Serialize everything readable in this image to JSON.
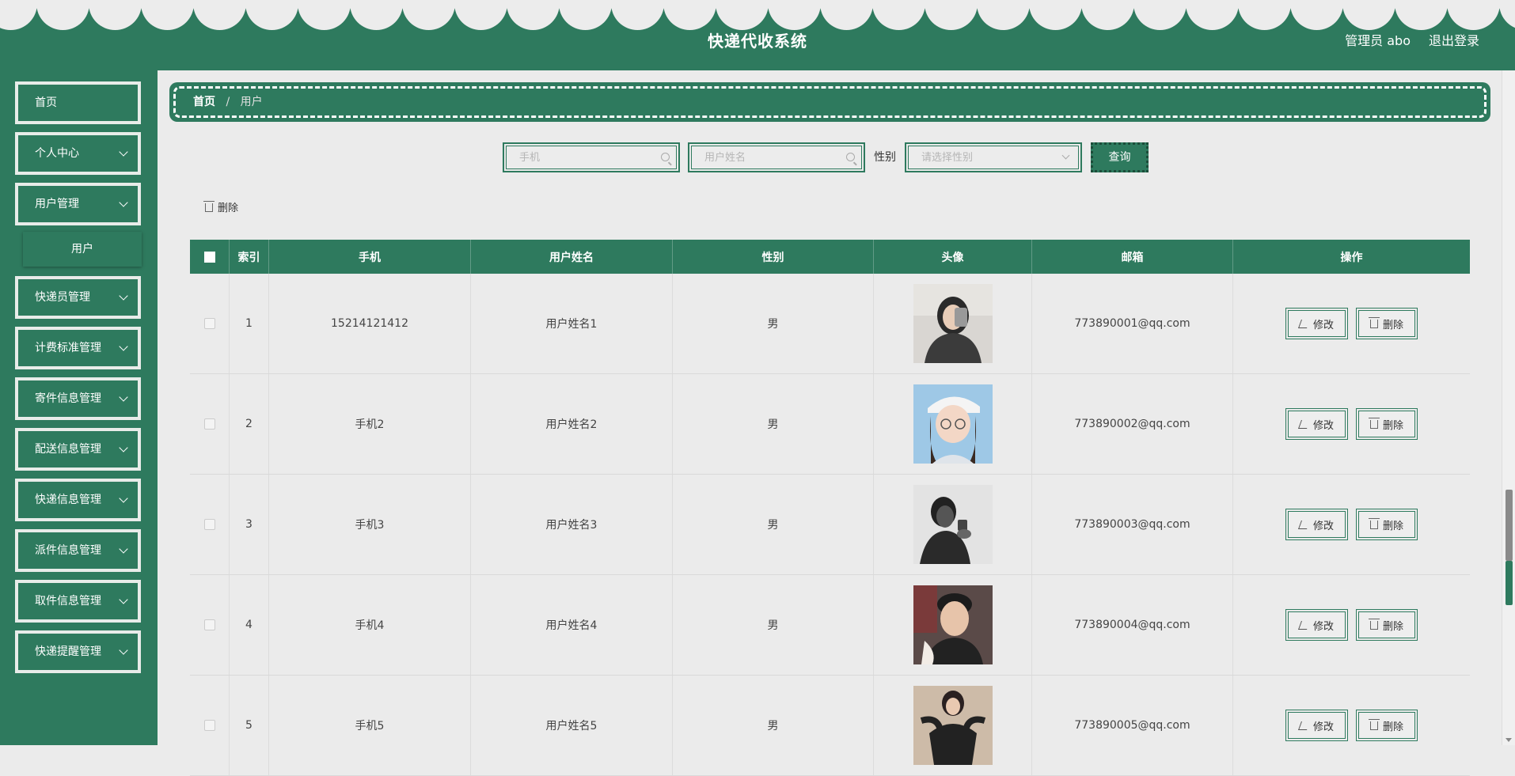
{
  "header": {
    "title": "快递代收系统",
    "user": "管理员 abo",
    "logout": "退出登录"
  },
  "sidebar": {
    "items": [
      {
        "label": "首页",
        "has_arrow": false
      },
      {
        "label": "个人中心",
        "has_arrow": true
      },
      {
        "label": "用户管理",
        "has_arrow": true
      },
      {
        "label": "快递员管理",
        "has_arrow": true
      },
      {
        "label": "计费标准管理",
        "has_arrow": true
      },
      {
        "label": "寄件信息管理",
        "has_arrow": true
      },
      {
        "label": "配送信息管理",
        "has_arrow": true
      },
      {
        "label": "快递信息管理",
        "has_arrow": true
      },
      {
        "label": "派件信息管理",
        "has_arrow": true
      },
      {
        "label": "取件信息管理",
        "has_arrow": true
      },
      {
        "label": "快递提醒管理",
        "has_arrow": true
      }
    ],
    "submenu_user": "用户"
  },
  "breadcrumb": {
    "home": "首页",
    "sep": "/",
    "current": "用户"
  },
  "search": {
    "phone_placeholder": "手机",
    "name_placeholder": "用户姓名",
    "gender_label": "性别",
    "gender_placeholder": "请选择性别",
    "query_label": "查询"
  },
  "toolbar": {
    "delete_label": "删除"
  },
  "table": {
    "headers": [
      "索引",
      "手机",
      "用户姓名",
      "性别",
      "头像",
      "邮箱",
      "操作"
    ],
    "rows": [
      {
        "index": "1",
        "phone": "15214121412",
        "name": "用户姓名1",
        "gender": "男",
        "email": "773890001@qq.com"
      },
      {
        "index": "2",
        "phone": "手机2",
        "name": "用户姓名2",
        "gender": "男",
        "email": "773890002@qq.com"
      },
      {
        "index": "3",
        "phone": "手机3",
        "name": "用户姓名3",
        "gender": "男",
        "email": "773890003@qq.com"
      },
      {
        "index": "4",
        "phone": "手机4",
        "name": "用户姓名4",
        "gender": "男",
        "email": "773890004@qq.com"
      },
      {
        "index": "5",
        "phone": "手机5",
        "name": "用户姓名5",
        "gender": "男",
        "email": "773890005@qq.com"
      }
    ],
    "edit_label": "修改",
    "delete_label": "删除"
  },
  "colors": {
    "primary": "#2e7a5e",
    "background": "#ebebeb"
  }
}
